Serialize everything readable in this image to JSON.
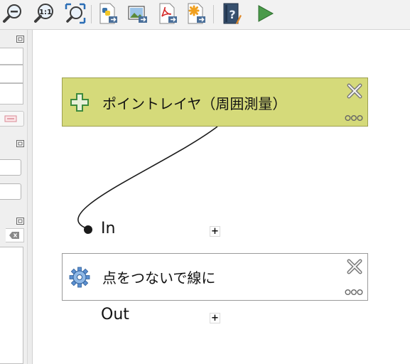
{
  "toolbar": {
    "buttons": [
      {
        "name": "zoom-out-icon"
      },
      {
        "name": "zoom-actual-icon",
        "label": "1:1"
      },
      {
        "name": "zoom-full-icon"
      },
      {
        "name": "export-python-icon"
      },
      {
        "name": "export-image-icon"
      },
      {
        "name": "export-pdf-icon"
      },
      {
        "name": "export-svg-icon"
      },
      {
        "name": "help-icon"
      },
      {
        "name": "run-model-icon"
      }
    ]
  },
  "canvas": {
    "input_node": {
      "label": "ポイントレイヤ（周囲測量）",
      "icon": "plus-icon",
      "color": "#d5da7a"
    },
    "algorithm_node": {
      "label": "点をつないで線に",
      "icon": "gear-icon"
    },
    "ports": {
      "in_label": "In",
      "out_label": "Out",
      "expand_symbol": "+"
    }
  },
  "colors": {
    "input_node_fill": "#d5da7a",
    "input_node_border": "#9da04f",
    "run_icon": "#4a9a4a"
  }
}
